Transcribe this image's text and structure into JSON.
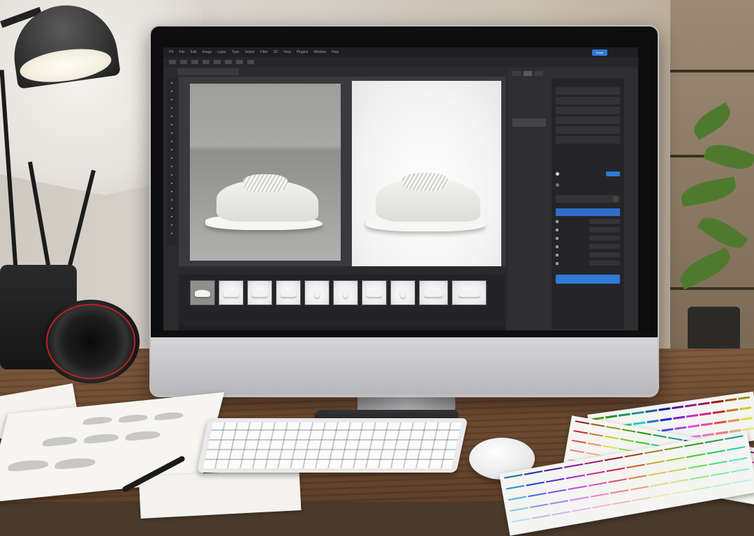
{
  "app": {
    "menu_items": [
      "PS",
      "File",
      "Edit",
      "Image",
      "Layer",
      "Type",
      "Select",
      "Filter",
      "3D",
      "View",
      "Plugins",
      "Window",
      "Help"
    ],
    "share_label": "Share",
    "document_tab": "",
    "tools": [
      "move",
      "marquee",
      "lasso",
      "crop",
      "eyedropper",
      "heal",
      "brush",
      "stamp",
      "history",
      "eraser",
      "gradient",
      "blur",
      "dodge",
      "pen",
      "type",
      "path",
      "shape",
      "hand",
      "zoom"
    ],
    "layers": [
      "",
      "",
      "",
      "",
      "",
      "",
      "",
      "",
      "",
      ""
    ],
    "active_layer_index": 5,
    "properties": {
      "title": "",
      "fields": [
        "",
        "",
        "",
        "",
        "",
        ""
      ],
      "radio": [
        "",
        ""
      ],
      "dropdown": "",
      "selected_option": "",
      "checks": [
        "",
        "",
        "",
        "",
        "",
        ""
      ],
      "apply_label": ""
    },
    "filmstrip_tabs": [
      "",
      "",
      "",
      ""
    ],
    "thumbnails": 10
  },
  "colors": {
    "accent": "#2f7ad6",
    "panel": "#2f2f31",
    "canvas": "#3a3a3c"
  },
  "icons": {
    "share": "share-button",
    "apply": "apply-button"
  }
}
